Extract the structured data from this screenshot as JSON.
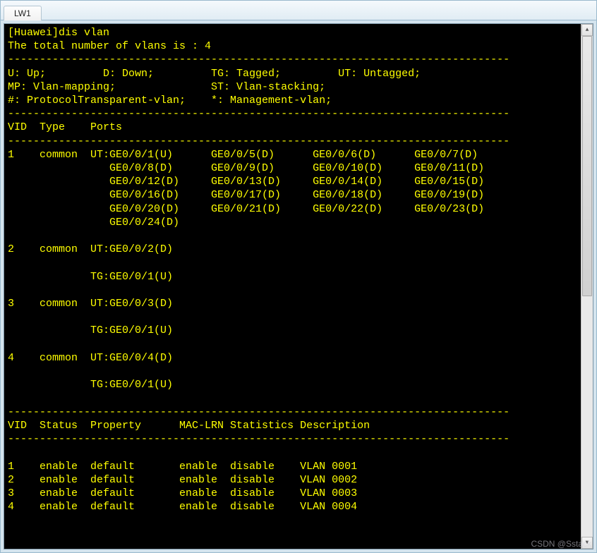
{
  "tab": {
    "label": "LW1"
  },
  "scrollbar": {
    "up": "▲",
    "down": "▼"
  },
  "watermark": "CSDN @Sstack",
  "term": {
    "prompt": "[Huawei]dis vlan",
    "total": "The total number of vlans is : 4",
    "dash": "-------------------------------------------------------------------------------",
    "legend1": "U: Up;         D: Down;         TG: Tagged;         UT: Untagged;",
    "legend2": "MP: Vlan-mapping;               ST: Vlan-stacking;",
    "legend3": "#: ProtocolTransparent-vlan;    *: Management-vlan;",
    "hdr1": "VID  Type    Ports",
    "v1r1": "1    common  UT:GE0/0/1(U)      GE0/0/5(D)      GE0/0/6(D)      GE0/0/7(D)",
    "v1r2": "                GE0/0/8(D)      GE0/0/9(D)      GE0/0/10(D)     GE0/0/11(D)",
    "v1r3": "                GE0/0/12(D)     GE0/0/13(D)     GE0/0/14(D)     GE0/0/15(D)",
    "v1r4": "                GE0/0/16(D)     GE0/0/17(D)     GE0/0/18(D)     GE0/0/19(D)",
    "v1r5": "                GE0/0/20(D)     GE0/0/21(D)     GE0/0/22(D)     GE0/0/23(D)",
    "v1r6": "                GE0/0/24(D)",
    "v2r1": "2    common  UT:GE0/0/2(D)",
    "v2r2": "             TG:GE0/0/1(U)",
    "v3r1": "3    common  UT:GE0/0/3(D)",
    "v3r2": "             TG:GE0/0/1(U)",
    "v4r1": "4    common  UT:GE0/0/4(D)",
    "v4r2": "             TG:GE0/0/1(U)",
    "hdr2": "VID  Status  Property      MAC-LRN Statistics Description",
    "s1": "1    enable  default       enable  disable    VLAN 0001",
    "s2": "2    enable  default       enable  disable    VLAN 0002",
    "s3": "3    enable  default       enable  disable    VLAN 0003",
    "s4": "4    enable  default       enable  disable    VLAN 0004"
  }
}
